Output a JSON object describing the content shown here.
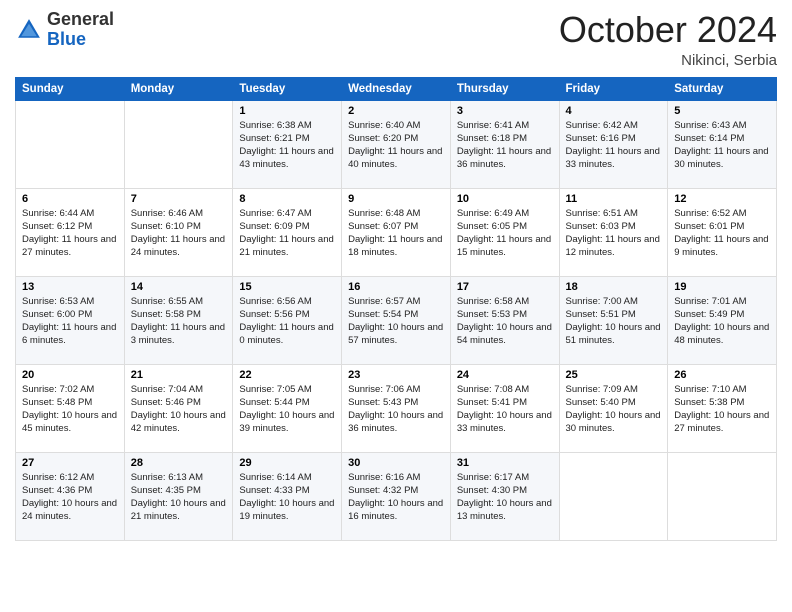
{
  "header": {
    "logo_general": "General",
    "logo_blue": "Blue",
    "month_title": "October 2024",
    "location": "Nikinci, Serbia"
  },
  "days_of_week": [
    "Sunday",
    "Monday",
    "Tuesday",
    "Wednesday",
    "Thursday",
    "Friday",
    "Saturday"
  ],
  "weeks": [
    [
      {
        "day": "",
        "info": ""
      },
      {
        "day": "",
        "info": ""
      },
      {
        "day": "1",
        "info": "Sunrise: 6:38 AM\nSunset: 6:21 PM\nDaylight: 11 hours and 43 minutes."
      },
      {
        "day": "2",
        "info": "Sunrise: 6:40 AM\nSunset: 6:20 PM\nDaylight: 11 hours and 40 minutes."
      },
      {
        "day": "3",
        "info": "Sunrise: 6:41 AM\nSunset: 6:18 PM\nDaylight: 11 hours and 36 minutes."
      },
      {
        "day": "4",
        "info": "Sunrise: 6:42 AM\nSunset: 6:16 PM\nDaylight: 11 hours and 33 minutes."
      },
      {
        "day": "5",
        "info": "Sunrise: 6:43 AM\nSunset: 6:14 PM\nDaylight: 11 hours and 30 minutes."
      }
    ],
    [
      {
        "day": "6",
        "info": "Sunrise: 6:44 AM\nSunset: 6:12 PM\nDaylight: 11 hours and 27 minutes."
      },
      {
        "day": "7",
        "info": "Sunrise: 6:46 AM\nSunset: 6:10 PM\nDaylight: 11 hours and 24 minutes."
      },
      {
        "day": "8",
        "info": "Sunrise: 6:47 AM\nSunset: 6:09 PM\nDaylight: 11 hours and 21 minutes."
      },
      {
        "day": "9",
        "info": "Sunrise: 6:48 AM\nSunset: 6:07 PM\nDaylight: 11 hours and 18 minutes."
      },
      {
        "day": "10",
        "info": "Sunrise: 6:49 AM\nSunset: 6:05 PM\nDaylight: 11 hours and 15 minutes."
      },
      {
        "day": "11",
        "info": "Sunrise: 6:51 AM\nSunset: 6:03 PM\nDaylight: 11 hours and 12 minutes."
      },
      {
        "day": "12",
        "info": "Sunrise: 6:52 AM\nSunset: 6:01 PM\nDaylight: 11 hours and 9 minutes."
      }
    ],
    [
      {
        "day": "13",
        "info": "Sunrise: 6:53 AM\nSunset: 6:00 PM\nDaylight: 11 hours and 6 minutes."
      },
      {
        "day": "14",
        "info": "Sunrise: 6:55 AM\nSunset: 5:58 PM\nDaylight: 11 hours and 3 minutes."
      },
      {
        "day": "15",
        "info": "Sunrise: 6:56 AM\nSunset: 5:56 PM\nDaylight: 11 hours and 0 minutes."
      },
      {
        "day": "16",
        "info": "Sunrise: 6:57 AM\nSunset: 5:54 PM\nDaylight: 10 hours and 57 minutes."
      },
      {
        "day": "17",
        "info": "Sunrise: 6:58 AM\nSunset: 5:53 PM\nDaylight: 10 hours and 54 minutes."
      },
      {
        "day": "18",
        "info": "Sunrise: 7:00 AM\nSunset: 5:51 PM\nDaylight: 10 hours and 51 minutes."
      },
      {
        "day": "19",
        "info": "Sunrise: 7:01 AM\nSunset: 5:49 PM\nDaylight: 10 hours and 48 minutes."
      }
    ],
    [
      {
        "day": "20",
        "info": "Sunrise: 7:02 AM\nSunset: 5:48 PM\nDaylight: 10 hours and 45 minutes."
      },
      {
        "day": "21",
        "info": "Sunrise: 7:04 AM\nSunset: 5:46 PM\nDaylight: 10 hours and 42 minutes."
      },
      {
        "day": "22",
        "info": "Sunrise: 7:05 AM\nSunset: 5:44 PM\nDaylight: 10 hours and 39 minutes."
      },
      {
        "day": "23",
        "info": "Sunrise: 7:06 AM\nSunset: 5:43 PM\nDaylight: 10 hours and 36 minutes."
      },
      {
        "day": "24",
        "info": "Sunrise: 7:08 AM\nSunset: 5:41 PM\nDaylight: 10 hours and 33 minutes."
      },
      {
        "day": "25",
        "info": "Sunrise: 7:09 AM\nSunset: 5:40 PM\nDaylight: 10 hours and 30 minutes."
      },
      {
        "day": "26",
        "info": "Sunrise: 7:10 AM\nSunset: 5:38 PM\nDaylight: 10 hours and 27 minutes."
      }
    ],
    [
      {
        "day": "27",
        "info": "Sunrise: 6:12 AM\nSunset: 4:36 PM\nDaylight: 10 hours and 24 minutes."
      },
      {
        "day": "28",
        "info": "Sunrise: 6:13 AM\nSunset: 4:35 PM\nDaylight: 10 hours and 21 minutes."
      },
      {
        "day": "29",
        "info": "Sunrise: 6:14 AM\nSunset: 4:33 PM\nDaylight: 10 hours and 19 minutes."
      },
      {
        "day": "30",
        "info": "Sunrise: 6:16 AM\nSunset: 4:32 PM\nDaylight: 10 hours and 16 minutes."
      },
      {
        "day": "31",
        "info": "Sunrise: 6:17 AM\nSunset: 4:30 PM\nDaylight: 10 hours and 13 minutes."
      },
      {
        "day": "",
        "info": ""
      },
      {
        "day": "",
        "info": ""
      }
    ]
  ]
}
